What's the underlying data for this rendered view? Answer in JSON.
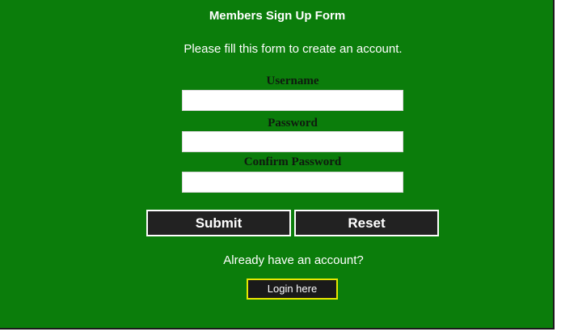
{
  "form": {
    "title": "Members Sign Up Form",
    "instructions": "Please fill this form to create an account.",
    "fields": {
      "username": {
        "label": "Username",
        "value": ""
      },
      "password": {
        "label": "Password",
        "value": ""
      },
      "confirm_password": {
        "label": "Confirm Password",
        "value": ""
      }
    },
    "submit_label": "Submit",
    "reset_label": "Reset",
    "account_prompt": "Already have an account?",
    "login_label": "Login here"
  },
  "colors": {
    "panel_background": "#0b7d0b",
    "button_background": "#222222",
    "login_border": "#e8e800",
    "text": "#ffffff"
  }
}
